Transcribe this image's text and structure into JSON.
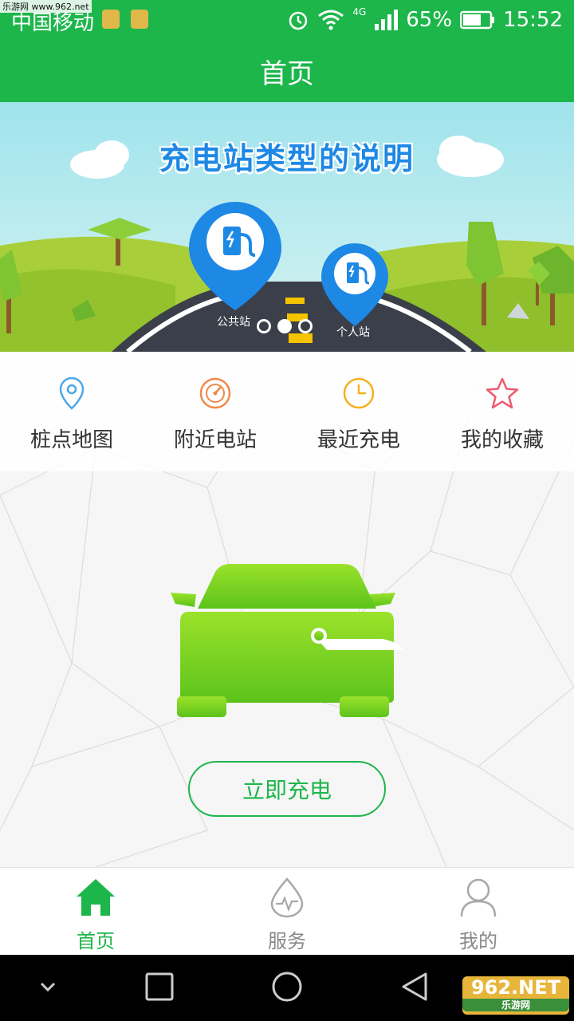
{
  "status_bar": {
    "watermark": "乐游网 www.962.net",
    "carrier": "中国移动",
    "network": "4G",
    "battery": "65%",
    "time": "15:52"
  },
  "header": {
    "title": "首页"
  },
  "banner": {
    "title": "充电站类型的说明",
    "pin_public": "公共站",
    "pin_personal": "个人站",
    "active_slide": 2,
    "slide_count": 3
  },
  "quick_actions": [
    {
      "label": "桩点地图",
      "icon": "map-pin-icon",
      "color": "#4aa8e8"
    },
    {
      "label": "附近电站",
      "icon": "gauge-icon",
      "color": "#f0884a"
    },
    {
      "label": "最近充电",
      "icon": "clock-icon",
      "color": "#f2b21c"
    },
    {
      "label": "我的收藏",
      "icon": "star-icon",
      "color": "#ee5a6f"
    }
  ],
  "main": {
    "charge_button": "立即充电"
  },
  "tabs": [
    {
      "label": "首页",
      "icon": "home-icon",
      "active": true
    },
    {
      "label": "服务",
      "icon": "service-drop-icon",
      "active": false
    },
    {
      "label": "我的",
      "icon": "user-icon",
      "active": false
    }
  ],
  "watermark_bottom": {
    "big": "962.NET",
    "small": "乐游网"
  },
  "colors": {
    "brand": "#1db64b",
    "accent_blue": "#1e88e5",
    "car_green": "#7ed321"
  }
}
